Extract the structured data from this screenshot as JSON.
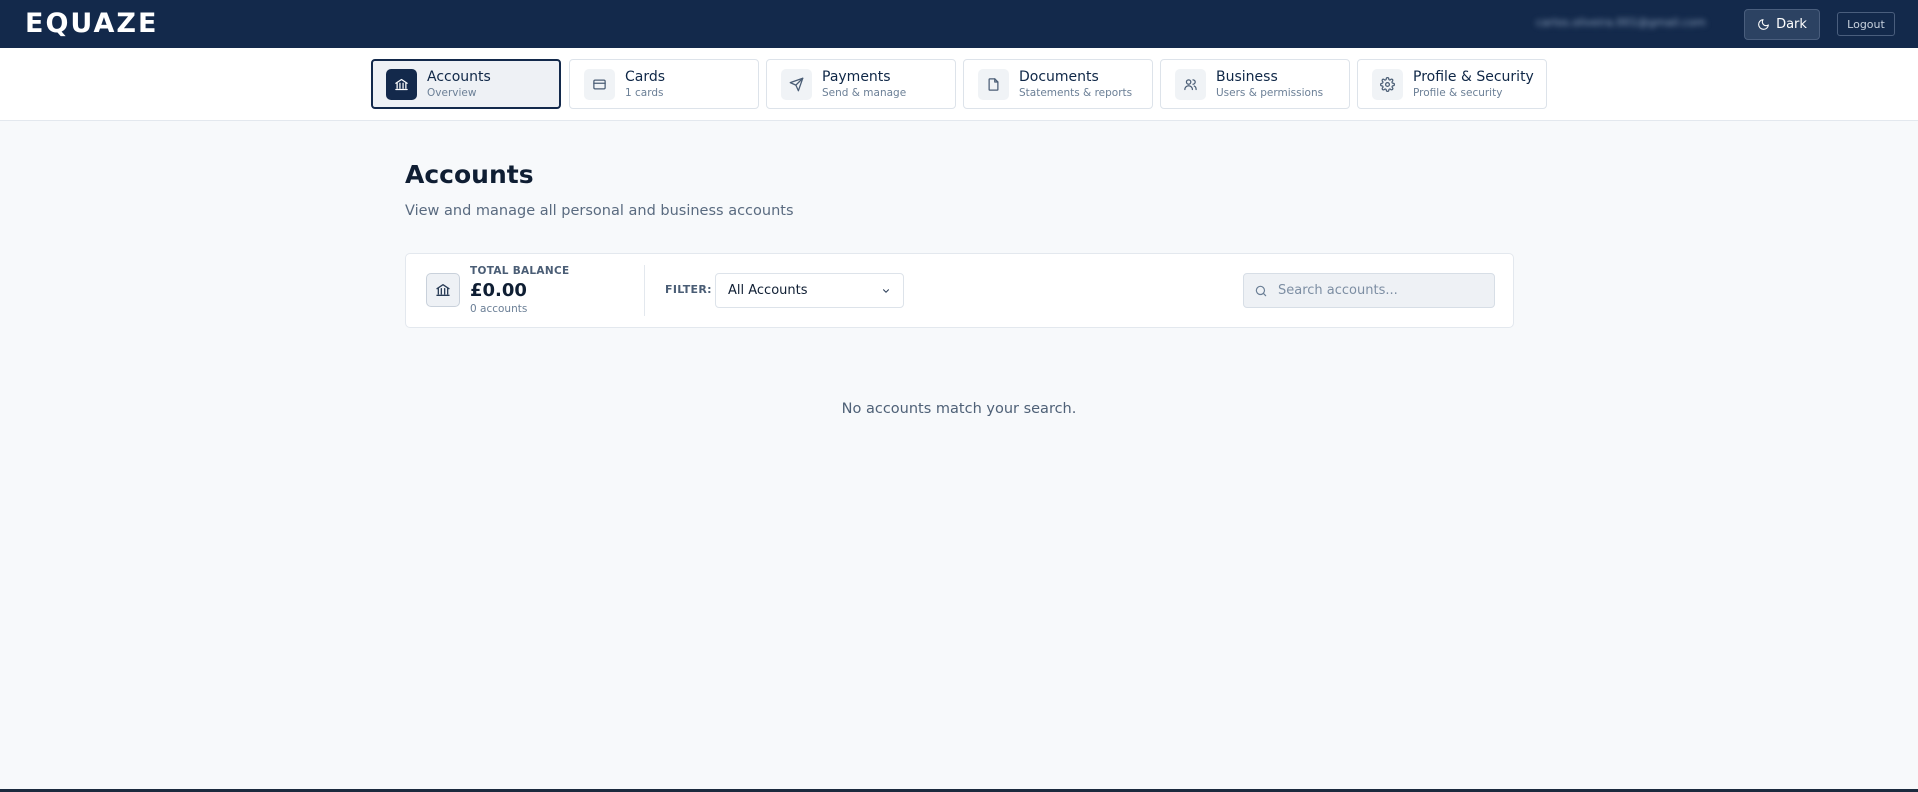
{
  "header": {
    "logo": "EQUAZE",
    "user_email": "carlos.oliveira.001@gmail.com",
    "theme_label": "Dark",
    "logout_label": "Logout"
  },
  "nav": {
    "tabs": [
      {
        "label": "Accounts",
        "sub": "Overview",
        "icon": "bank-icon",
        "active": true
      },
      {
        "label": "Cards",
        "sub": "1 cards",
        "icon": "credit-card-icon",
        "active": false
      },
      {
        "label": "Payments",
        "sub": "Send & manage",
        "icon": "send-icon",
        "active": false
      },
      {
        "label": "Documents",
        "sub": "Statements & reports",
        "icon": "document-icon",
        "active": false
      },
      {
        "label": "Business",
        "sub": "Users & permissions",
        "icon": "users-icon",
        "active": false
      },
      {
        "label": "Profile & Security",
        "sub": "Profile & security",
        "icon": "gear-icon",
        "active": false
      }
    ]
  },
  "page": {
    "title": "Accounts",
    "subtitle": "View and manage all personal and business accounts"
  },
  "summary": {
    "balance_label": "TOTAL BALANCE",
    "balance_value": "£0.00",
    "account_count": "0 accounts",
    "filter_label": "FILTER:",
    "filter_selected": "All Accounts",
    "search_placeholder": "Search accounts..."
  },
  "empty_state": {
    "message": "No accounts match your search."
  },
  "colors": {
    "brand": "#13294b",
    "background": "#f7f9fb",
    "surface": "#ffffff",
    "border": "#e3e8ee"
  }
}
